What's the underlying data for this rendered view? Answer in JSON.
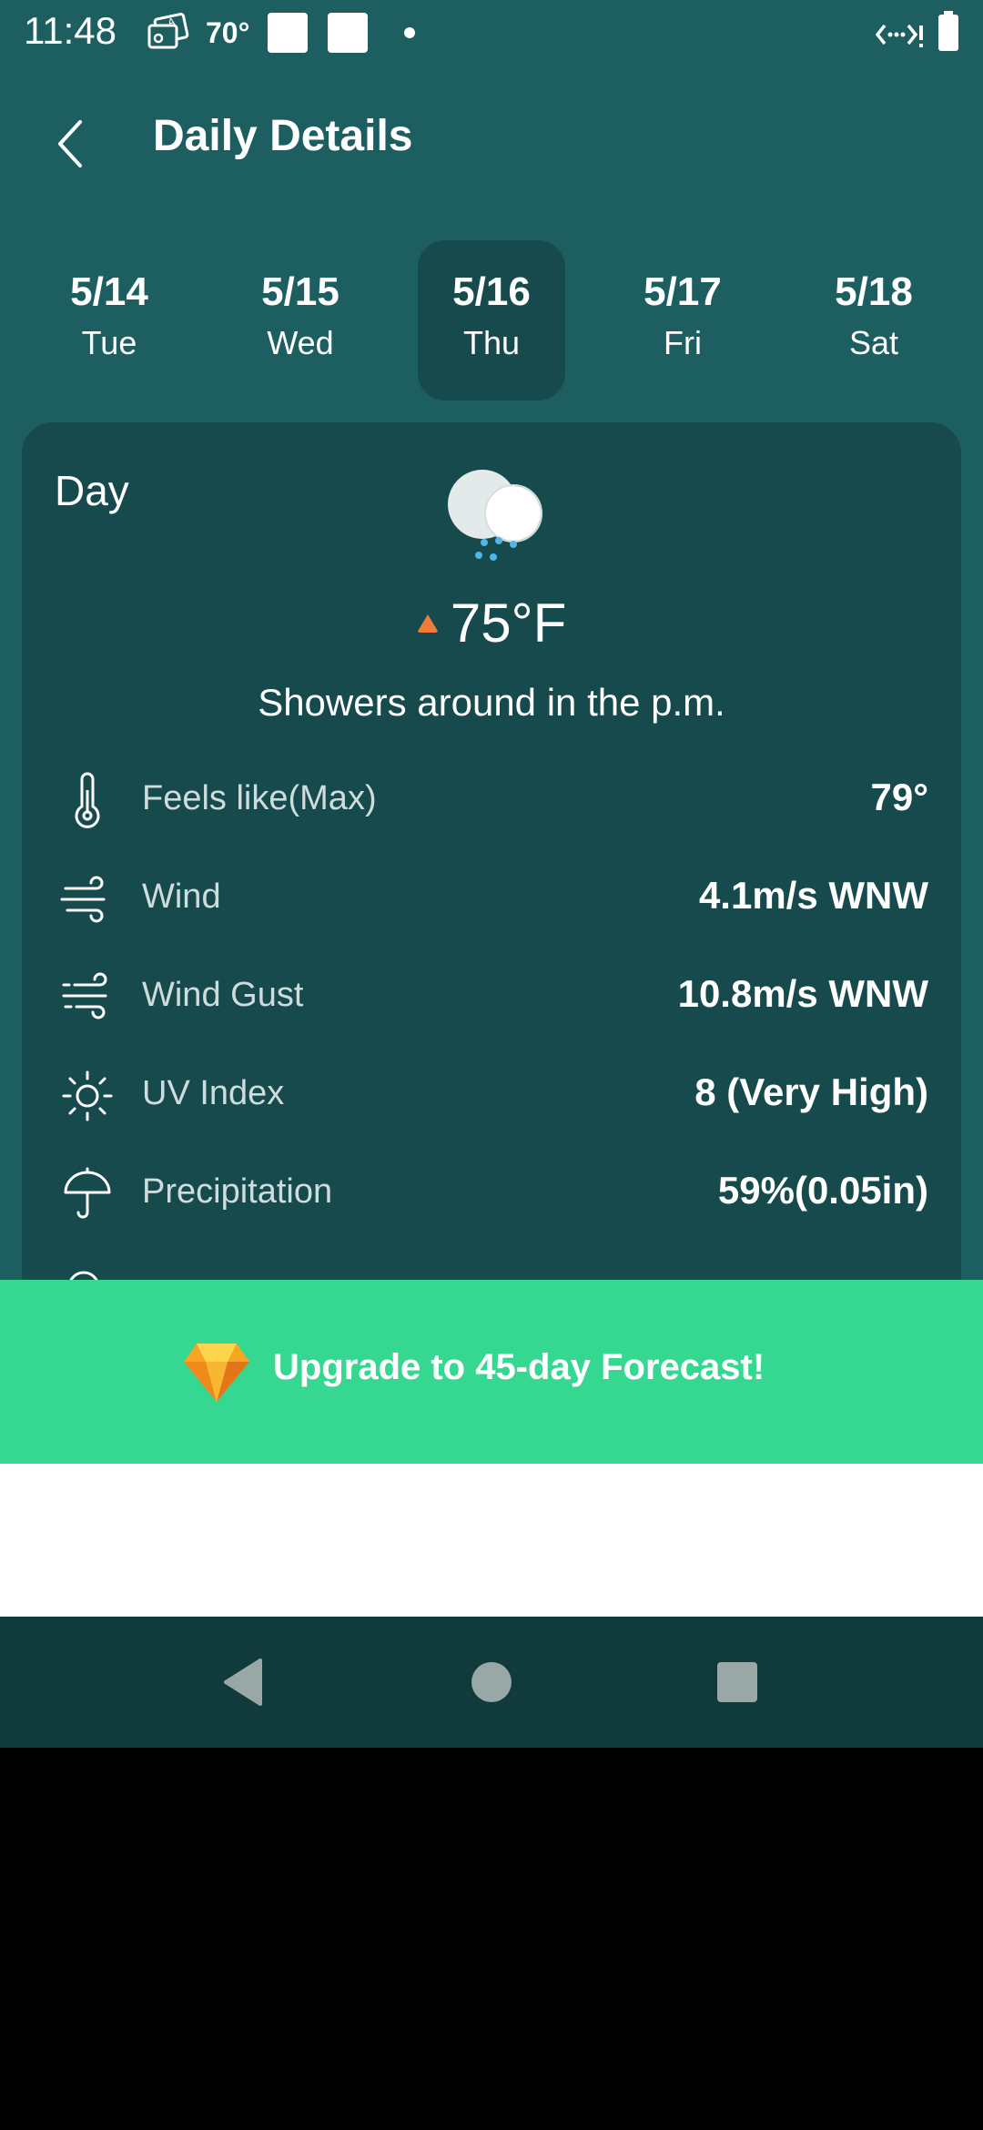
{
  "status_bar": {
    "time": "11:48",
    "temperature": "70°",
    "icons": [
      "photo-translate-icon",
      "notification-square-icon",
      "notification-square-icon",
      "dot-icon",
      "data-transfer-icon",
      "battery-icon"
    ]
  },
  "header": {
    "title": "Daily Details",
    "back_icon": "chevron-left-icon"
  },
  "tabs": [
    {
      "date": "5/14",
      "day": "Tue",
      "active": false
    },
    {
      "date": "5/15",
      "day": "Wed",
      "active": false
    },
    {
      "date": "5/16",
      "day": "Thu",
      "active": true
    },
    {
      "date": "5/17",
      "day": "Fri",
      "active": false
    },
    {
      "date": "5/18",
      "day": "Sat",
      "active": false
    }
  ],
  "card": {
    "label": "Day",
    "weather_icon": "cloud-showers-icon",
    "temperature": "75°F",
    "condition": "Showers around in the p.m.",
    "details": [
      {
        "icon": "thermometer-icon",
        "label": "Feels like(Max)",
        "value": "79°"
      },
      {
        "icon": "wind-icon",
        "label": "Wind",
        "value": "4.1m/s WNW"
      },
      {
        "icon": "wind-gust-icon",
        "label": "Wind Gust",
        "value": "10.8m/s WNW"
      },
      {
        "icon": "sun-icon",
        "label": "UV Index",
        "value": "8 (Very High)"
      },
      {
        "icon": "umbrella-icon",
        "label": "Precipitation",
        "value": "59%(0.05in)"
      }
    ]
  },
  "banner": {
    "icon": "diamond-icon",
    "text": "Upgrade to 45-day Forecast!"
  },
  "colors": {
    "background": "#1d5e60",
    "card": "#164a4c",
    "banner": "#36d891",
    "temp_arrow": "#f07b3a",
    "navbar": "#113a3c"
  }
}
